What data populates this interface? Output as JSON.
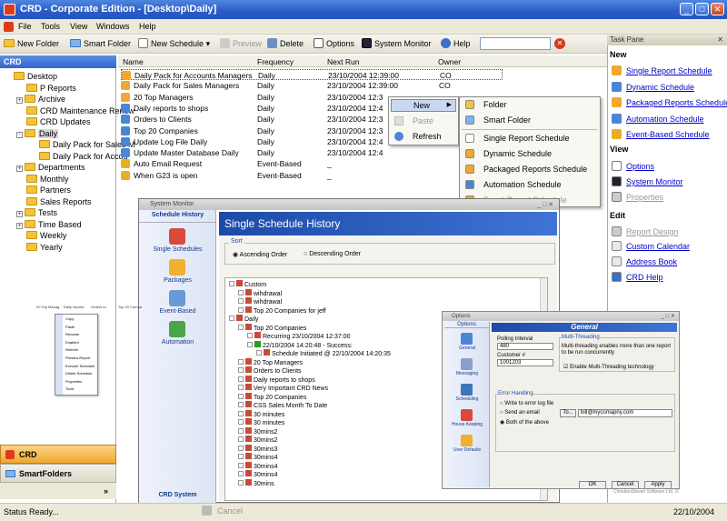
{
  "window": {
    "title": "CRD - Corporate Edition - [Desktop\\Daily]",
    "minimize": "_",
    "maximize": "□",
    "close": "✕"
  },
  "menubar": [
    "File",
    "Tools",
    "View",
    "Windows",
    "Help"
  ],
  "toolbar": {
    "new_folder": "New Folder",
    "smart_folder": "Smart Folder",
    "new_schedule": "New Schedule",
    "preview": "Preview",
    "delete": "Delete",
    "options": "Options",
    "system_monitor": "System Monitor",
    "help": "Help",
    "search_value": ""
  },
  "tree": {
    "header": "CRD",
    "items": [
      {
        "label": "Desktop",
        "level": 0,
        "expander": ""
      },
      {
        "label": "P Reports",
        "level": 1,
        "expander": ""
      },
      {
        "label": "Archive",
        "level": 1,
        "expander": "+"
      },
      {
        "label": "CRD Maintenance Renew",
        "level": 1,
        "expander": ""
      },
      {
        "label": "CRD Updates",
        "level": 1,
        "expander": ""
      },
      {
        "label": "Daily",
        "level": 1,
        "expander": "-"
      },
      {
        "label": "Daily Pack for Sales M",
        "level": 2,
        "expander": ""
      },
      {
        "label": "Daily Pack for Accou",
        "level": 2,
        "expander": ""
      },
      {
        "label": "Departments",
        "level": 1,
        "expander": "+"
      },
      {
        "label": "Monthly",
        "level": 1,
        "expander": ""
      },
      {
        "label": "Partners",
        "level": 1,
        "expander": ""
      },
      {
        "label": "Sales Reports",
        "level": 1,
        "expander": ""
      },
      {
        "label": "Tests",
        "level": 1,
        "expander": "+"
      },
      {
        "label": "Time Based",
        "level": 1,
        "expander": "+"
      },
      {
        "label": "Weekly",
        "level": 1,
        "expander": ""
      },
      {
        "label": "Yearly",
        "level": 1,
        "expander": ""
      }
    ]
  },
  "bottom_buttons": {
    "crd": "CRD",
    "smartfolders": "SmartFolders",
    "more": "»"
  },
  "list": {
    "columns": [
      "Name",
      "Frequency",
      "Next Run",
      "Owner"
    ],
    "rows": [
      {
        "name": "Daily Pack for Accounts Managers",
        "freq": "Daily",
        "next": "23/10/2004 12:39:00",
        "owner": "CO"
      },
      {
        "name": "Daily Pack for Sales Managers",
        "freq": "Daily",
        "next": "23/10/2004 12:39:00",
        "owner": "CO"
      },
      {
        "name": "20 Top Managers",
        "freq": "Daily",
        "next": "23/10/2004 12:3",
        "owner": ""
      },
      {
        "name": "Daily reports to shops",
        "freq": "Daily",
        "next": "23/10/2004 12:4",
        "owner": ""
      },
      {
        "name": "Orders to Clients",
        "freq": "Daily",
        "next": "23/10/2004 12:3",
        "owner": ""
      },
      {
        "name": "Top 20 Companies",
        "freq": "Daily",
        "next": "23/10/2004 12:3",
        "owner": ""
      },
      {
        "name": "Update Log File Daily",
        "freq": "Daily",
        "next": "23/10/2004 12:4",
        "owner": ""
      },
      {
        "name": "Update Master Database Daily",
        "freq": "Daily",
        "next": "23/10/2004 12:4",
        "owner": ""
      },
      {
        "name": "Auto Email Request",
        "freq": "Event-Based",
        "next": "_",
        "owner": ""
      },
      {
        "name": "When G23 is open",
        "freq": "Event-Based",
        "next": "_",
        "owner": ""
      }
    ]
  },
  "context_menu": {
    "new": "New",
    "paste": "Paste",
    "refresh": "Refresh",
    "arrow": "▶"
  },
  "submenu": [
    "Folder",
    "Smart Folder",
    "Single Report Schedule",
    "Dynamic Schedule",
    "Packaged Reports Schedule",
    "Automation Schedule",
    "Event-Based Schedule"
  ],
  "taskpane": {
    "title": "Task Pane",
    "close": "✕",
    "sections": {
      "new": "New",
      "view": "View",
      "edit": "Edit"
    },
    "new_items": [
      "Single Report Schedule",
      "Dynamic Schedule",
      "Packaged Reports Schedule",
      "Automation Schedule",
      "Event-Based Schedule"
    ],
    "view_items": [
      "Options",
      "System Monitor",
      "Properties"
    ],
    "edit_items": [
      "Report Design",
      "Custom Calendar",
      "Address Book",
      "CRD Help"
    ]
  },
  "status": {
    "text": "Status Ready...",
    "cancel": "Cancel",
    "date": "22/10/2004"
  },
  "system_monitor": {
    "title": "System Monitor",
    "nav_head": "Schedule History",
    "nav": [
      "Single Schedules",
      "Packages",
      "Event-Based",
      "Automation"
    ],
    "nav_foot": "CRD System",
    "heading": "Single Schedule History",
    "sort_label": "Sort",
    "sort_asc": "Ascending Order",
    "sort_desc": "Descending Order",
    "history": [
      "Custom",
      "wihdrawal",
      "wihdrawal",
      "Top 20 Companies for jeff",
      "Daily",
      "Top 20 Companies",
      "Recurring 23/10/2004 12:37:00",
      "22/10/2004 14:20:48 - Success:",
      "Schedule Initiated @ 22/10/2004 14:20:35",
      "20 Top Managers",
      "Orders to Clients",
      "Daily reports to shops",
      "Very Important CRD News",
      "Top 20 Companies",
      "CSS Sales Month To Date",
      "30 minutes",
      "30 minutes",
      "30mins2",
      "30mins2",
      "30mins3",
      "30mins4",
      "30mins4",
      "30mins4",
      "30mins"
    ]
  },
  "mini_menu": {
    "cols": [
      "20 Top Manag",
      "Daily reports",
      "Orders to",
      "Top 20 Companies"
    ],
    "items": [
      "Copy",
      "Paste",
      "Rename",
      "Enabled",
      "Refresh",
      "Preview Report",
      "Execute Schedule",
      "Delete Schedule",
      "Properties",
      "Tools"
    ]
  },
  "options": {
    "title": "Options",
    "nav_head": "Options",
    "nav": [
      "General",
      "Messaging",
      "Scheduling",
      "House Keeping",
      "User Defaults"
    ],
    "heading": "General",
    "polling_label": "Polling Interval",
    "polling_value": "480",
    "customer_label": "Customer #",
    "customer_value": "1001203",
    "mt_label": "Multi-Threading",
    "mt_desc": "Multi-threading enables more than one report to be run concurrently",
    "mt_check": "Enable Multi-Threading technology",
    "error_label": "Error Handling",
    "err1": "Write to error log file",
    "err2": "Send an email",
    "err3": "Both of the above",
    "to_label": "To...",
    "email": "bill@mycomapny.com",
    "ok": "OK",
    "cancel": "Cancel",
    "apply": "Apply",
    "footer": "ChristianSteven Software Ltd. 2003 - 2004"
  }
}
